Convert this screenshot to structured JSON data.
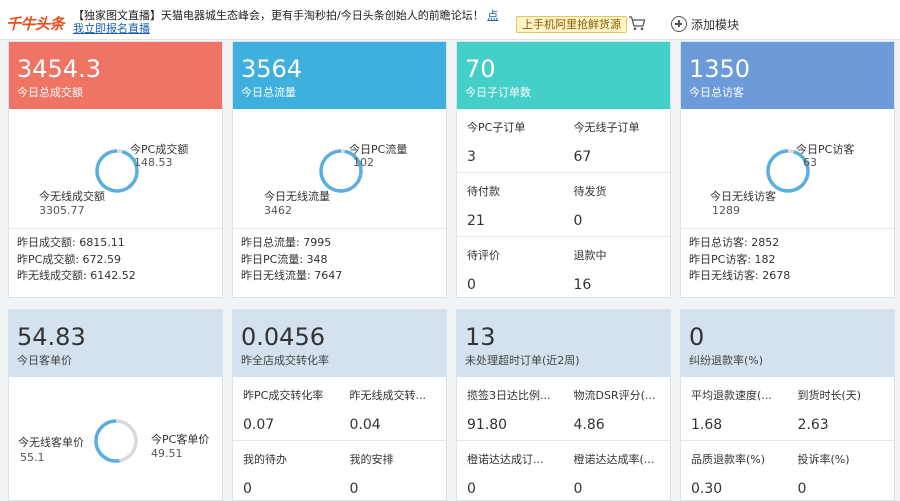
{
  "topbar": {
    "logo": "千牛头条",
    "news_text": "【独家图文直播】天猫电器城生态峰会，更有手淘秒拍/今日头条创始人的前瞻论坛！",
    "news_link": "点我立即报名直播",
    "promo": "上手机阿里抢鲜货源",
    "add_module": "添加模块"
  },
  "cards": {
    "gmv": {
      "big": "3454.3",
      "sub": "今日总成交额",
      "pc_label": "今PC成交额",
      "pc_value": "148.53",
      "wl_label": "今无线成交额",
      "wl_value": "3305.77",
      "yesterday": [
        "昨日成交额: 6815.11",
        "昨PC成交额: 672.59",
        "昨无线成交额: 6142.52"
      ]
    },
    "traffic": {
      "big": "3564",
      "sub": "今日总流量",
      "pc_label": "今日PC流量",
      "pc_value": "102",
      "wl_label": "今日无线流量",
      "wl_value": "3462",
      "yesterday": [
        "昨日总流量: 7995",
        "昨日PC流量: 348",
        "昨日无线流量: 7647"
      ]
    },
    "suborders": {
      "big": "70",
      "sub": "今日子订单数",
      "cells": [
        {
          "label": "今PC子订单",
          "value": "3"
        },
        {
          "label": "今无线子订单",
          "value": "67"
        },
        {
          "label": "待付款",
          "value": "21"
        },
        {
          "label": "待发货",
          "value": "0"
        },
        {
          "label": "待评价",
          "value": "0"
        },
        {
          "label": "退款中",
          "value": "16"
        }
      ]
    },
    "visitors": {
      "big": "1350",
      "sub": "今日总访客",
      "pc_label": "今日PC访客",
      "pc_value": "63",
      "wl_label": "今日无线访客",
      "wl_value": "1289",
      "yesterday": [
        "昨日总访客: 2852",
        "昨日PC访客: 182",
        "昨日无线访客: 2678"
      ]
    },
    "unit_price": {
      "big": "54.83",
      "sub": "今日客单价",
      "pc_label": "今PC客单价",
      "pc_value": "49.51",
      "wl_label": "今无线客单价",
      "wl_value": "55.1"
    },
    "conversion": {
      "big": "0.0456",
      "sub": "昨全店成交转化率",
      "cells": [
        {
          "label": "昨PC成交转化率",
          "value": "0.07"
        },
        {
          "label": "昨无线成交转...",
          "value": "0.04"
        },
        {
          "label": "我的待办",
          "value": "0"
        },
        {
          "label": "我的安排",
          "value": "0"
        }
      ]
    },
    "overtime": {
      "big": "13",
      "sub": "未处理超时订单(近2周)",
      "cells": [
        {
          "label": "揽签3日达比例...",
          "value": "91.80"
        },
        {
          "label": "物流DSR评分(...",
          "value": "4.86"
        },
        {
          "label": "橙诺达达成订...",
          "value": "0"
        },
        {
          "label": "橙诺达达成率(...",
          "value": "0"
        }
      ]
    },
    "dispute": {
      "big": "0",
      "sub": "纠纷退款率(%)",
      "cells": [
        {
          "label": "平均退款速度(...",
          "value": "1.68"
        },
        {
          "label": "到货时长(天)",
          "value": "2.63"
        },
        {
          "label": "品质退款率(%)",
          "value": "0.30"
        },
        {
          "label": "投诉率(%)",
          "value": "0"
        }
      ]
    }
  },
  "colors": {
    "red": "#f07464",
    "blue": "#3fb0de",
    "teal": "#45cfc9",
    "steel": "#6d9bd9",
    "pale": "#d4e2f0",
    "ring": "#5aaee0",
    "ring_track": "#d9d9d9"
  },
  "chart_data": [
    {
      "type": "pie",
      "categories": [
        "今PC成交额",
        "今无线成交额"
      ],
      "values": [
        148.53,
        3305.77
      ]
    },
    {
      "type": "pie",
      "categories": [
        "今日PC流量",
        "今日无线流量"
      ],
      "values": [
        102,
        3462
      ]
    },
    {
      "type": "pie",
      "categories": [
        "今日PC访客",
        "今日无线访客"
      ],
      "values": [
        63,
        1289
      ]
    },
    {
      "type": "pie",
      "categories": [
        "今PC客单价",
        "今无线客单价"
      ],
      "values": [
        49.51,
        55.1
      ]
    }
  ]
}
